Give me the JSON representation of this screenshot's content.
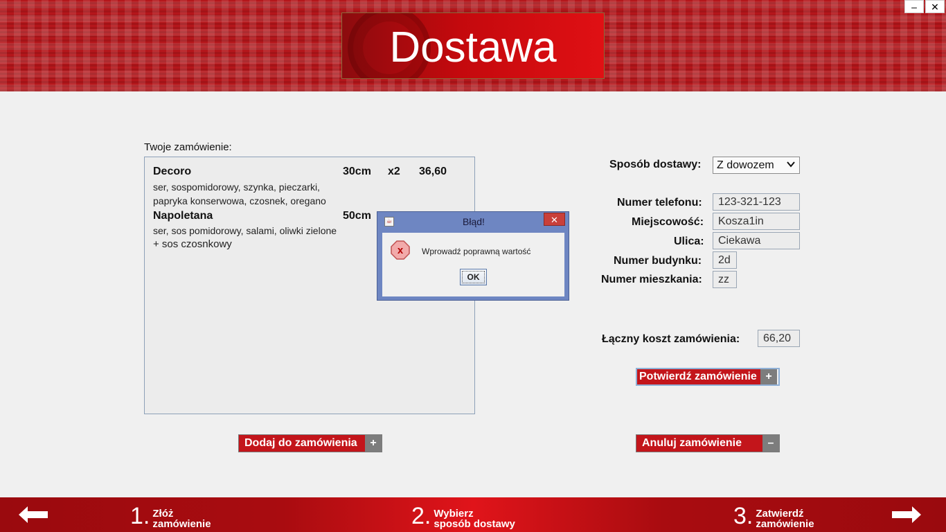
{
  "header": {
    "title": "Dostawa",
    "minimize": "–",
    "close": "✕"
  },
  "order": {
    "label": "Twoje zamówienie:",
    "items": [
      {
        "name": "Decoro",
        "size": "30cm",
        "qty": "x2",
        "price": "36,60",
        "desc_line1": "ser, sospomidorowy, szynka, pieczarki,",
        "desc_line2": "papryka konserwowa, czosnek, oregano"
      },
      {
        "name": "Napoletana",
        "size": "50cm",
        "desc_line1": "ser, sos pomidorowy, salami, oliwki zielone",
        "extra": "+ sos czosnkowy"
      }
    ]
  },
  "buttons": {
    "add": {
      "label": "Dodaj do zamówienia",
      "icon": "+"
    },
    "confirm": {
      "label": "Potwierdź zamówienie",
      "icon": "+"
    },
    "cancel": {
      "label": "Anuluj zamówienie",
      "icon": "–"
    }
  },
  "form": {
    "delivery": {
      "label": "Sposób dostawy:",
      "value": "Z dowozem"
    },
    "phone": {
      "label": "Numer telefonu:",
      "value": "123-321-123"
    },
    "city": {
      "label": "Miejscowość:",
      "value": "Kosza1in"
    },
    "street": {
      "label": "Ulica:",
      "value": "Ciekawa"
    },
    "building": {
      "label": "Numer budynku:",
      "value": "2d"
    },
    "apartment": {
      "label": "Numer mieszkania:",
      "value": "zz"
    },
    "total": {
      "label": "Łączny koszt zamówienia:",
      "value": "66,20"
    }
  },
  "dialog": {
    "title": "Błąd!",
    "message": "Wprowadź poprawną wartość",
    "ok": "OK",
    "close": "✕",
    "icon": "error-icon"
  },
  "footer": {
    "steps": [
      {
        "num": "1.",
        "line1": "Złóż",
        "line2": "zamówienie"
      },
      {
        "num": "2.",
        "line1": "Wybierz",
        "line2": "sposób dostawy"
      },
      {
        "num": "3.",
        "line1": "Zatwierdź",
        "line2": "zamówienie"
      }
    ]
  },
  "colors": {
    "brand_red": "#c3151b",
    "dialog_frame": "#6e86c2",
    "icon_gray": "#7d7d7d"
  }
}
